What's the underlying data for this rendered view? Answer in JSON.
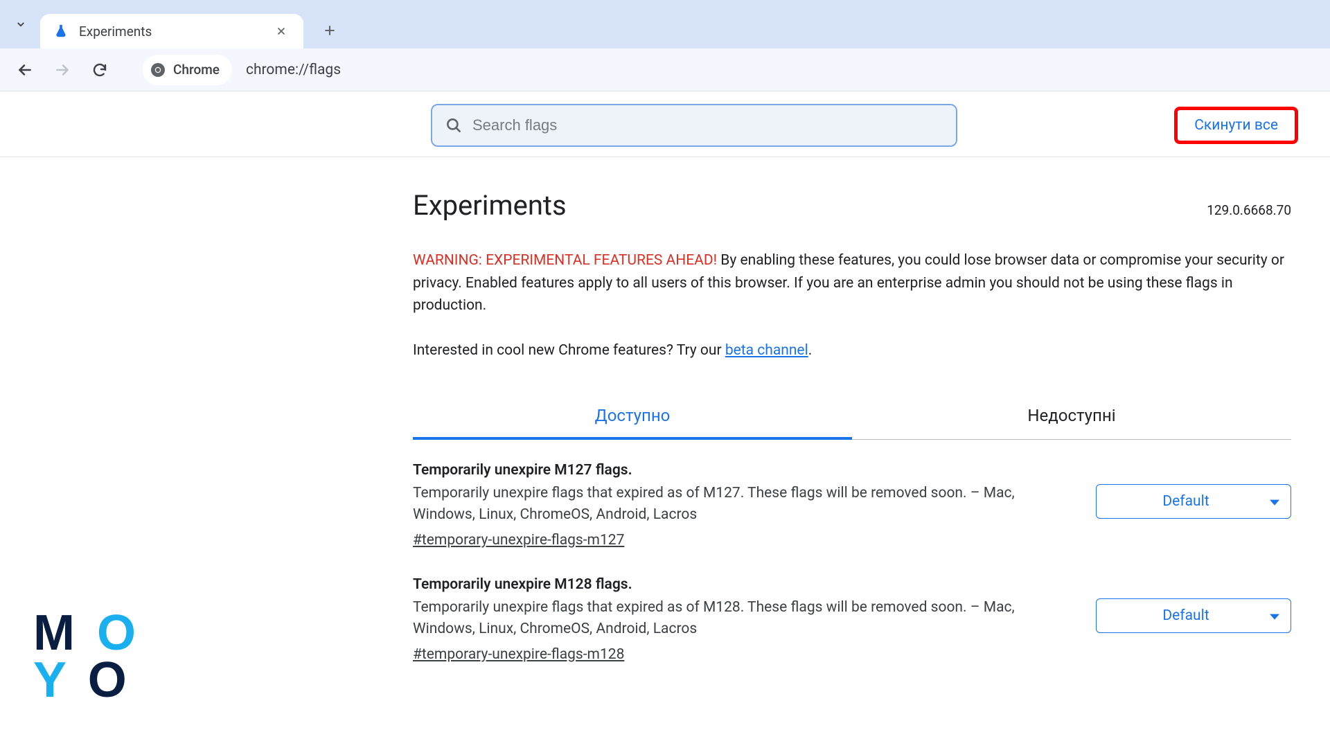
{
  "browser": {
    "tab_title": "Experiments",
    "url_chip_label": "Chrome",
    "url": "chrome://flags"
  },
  "search": {
    "placeholder": "Search flags"
  },
  "reset_button_label": "Скинути все",
  "page_title": "Experiments",
  "version": "129.0.6668.70",
  "warning_prefix": "WARNING: EXPERIMENTAL FEATURES AHEAD!",
  "warning_body": " By enabling these features, you could lose browser data or compromise your security or privacy. Enabled features apply to all users of this browser. If you are an enterprise admin you should not be using these flags in production.",
  "interest_prefix": "Interested in cool new Chrome features? Try our ",
  "beta_link_text": "beta channel",
  "interest_suffix": ".",
  "tabs": {
    "available": "Доступно",
    "unavailable": "Недоступні"
  },
  "flags": [
    {
      "title": "Temporarily unexpire M127 flags.",
      "desc": "Temporarily unexpire flags that expired as of M127. These flags will be removed soon. – Mac, Windows, Linux, ChromeOS, Android, Lacros",
      "anchor": "#temporary-unexpire-flags-m127",
      "value": "Default"
    },
    {
      "title": "Temporarily unexpire M128 flags.",
      "desc": "Temporarily unexpire flags that expired as of M128. These flags will be removed soon. – Mac, Windows, Linux, ChromeOS, Android, Lacros",
      "anchor": "#temporary-unexpire-flags-m128",
      "value": "Default"
    }
  ],
  "logo": {
    "m": "M",
    "o1": "O",
    "y": "Y",
    "o2": "O"
  }
}
